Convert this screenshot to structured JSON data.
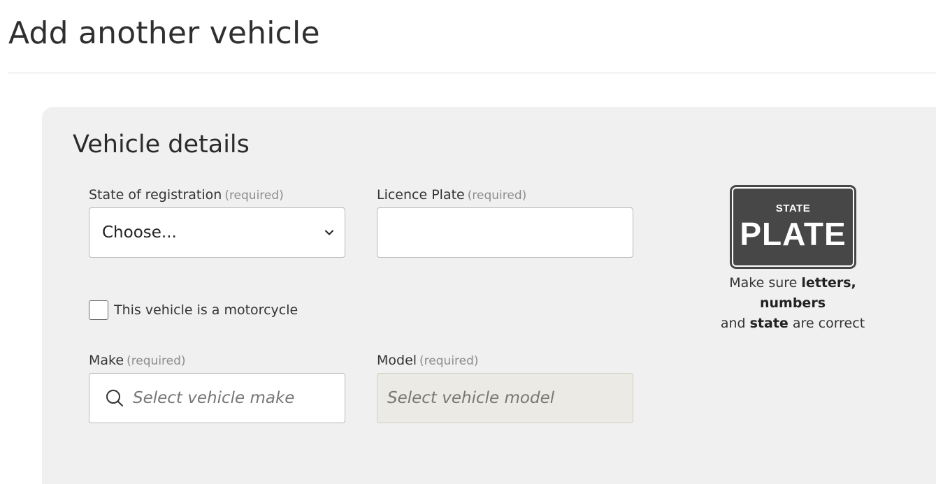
{
  "page": {
    "title": "Add another vehicle"
  },
  "section": {
    "title": "Vehicle details"
  },
  "state_field": {
    "label": "State of registration",
    "required": "(required)",
    "selected": "Choose..."
  },
  "plate_field": {
    "label": "Licence Plate",
    "required": "(required)",
    "value": ""
  },
  "motorcycle": {
    "label": "This vehicle is a motorcycle",
    "checked": false
  },
  "make_field": {
    "label": "Make",
    "required": "(required)",
    "placeholder": "Select vehicle make",
    "icon": "search-icon"
  },
  "model_field": {
    "label": "Model",
    "required": "(required)",
    "placeholder": "Select vehicle model",
    "disabled": true
  },
  "plate_graphic": {
    "state": "STATE",
    "text": "PLATE"
  },
  "plate_hint": {
    "part1": "Make sure ",
    "bold1": "letters, numbers",
    "part2": "and ",
    "bold2": "state",
    "part3": " are correct"
  },
  "colors": {
    "panel_bg": "#f0f0f0",
    "plate_bg": "#474747",
    "disabled_bg": "#ebeae4"
  }
}
